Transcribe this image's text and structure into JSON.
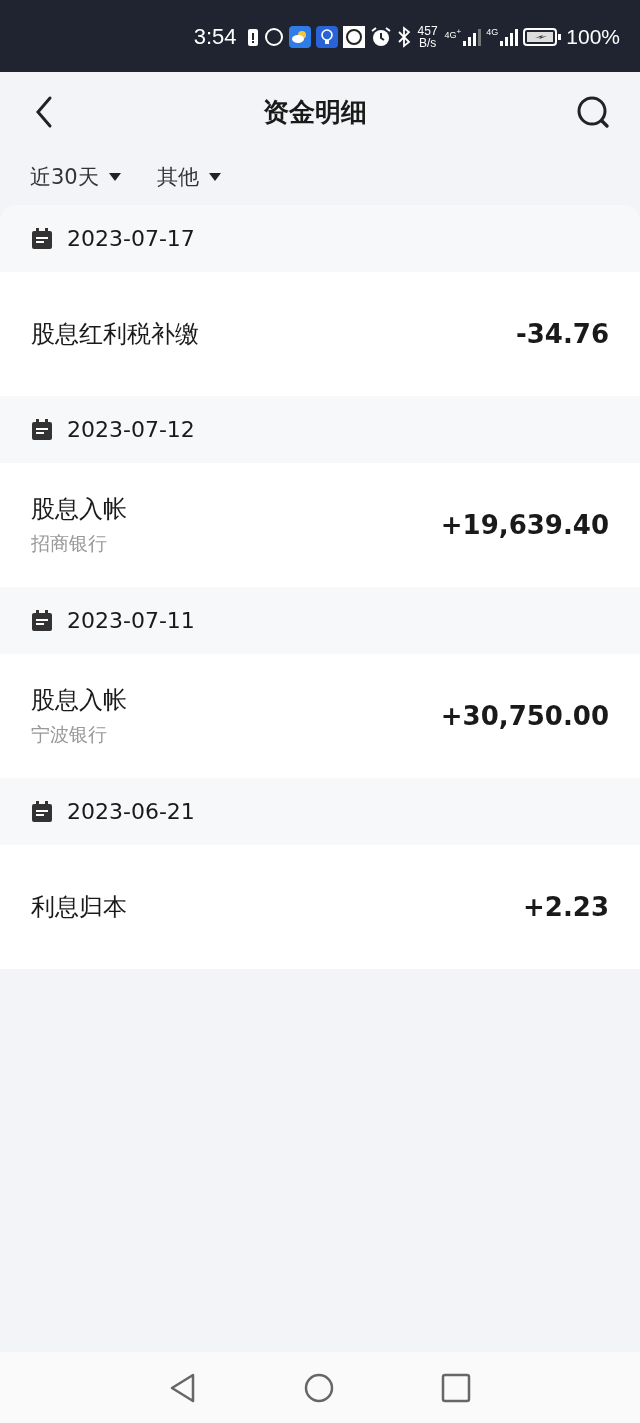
{
  "status_bar": {
    "time": "3:54",
    "net_speed": "457",
    "net_unit": "B/s",
    "signal_1": "4G$^{+}$",
    "signal_2": "4G",
    "battery": "100%"
  },
  "header": {
    "title": "资金明细"
  },
  "filters": [
    {
      "label": "近30天"
    },
    {
      "label": "其他"
    }
  ],
  "groups": [
    {
      "date": "2023-07-17",
      "items": [
        {
          "title": "股息红利税补缴",
          "amount": "-34.76"
        }
      ]
    },
    {
      "date": "2023-07-12",
      "items": [
        {
          "title": "股息入帐",
          "subtitle": "招商银行",
          "amount": "+19,639.40"
        }
      ]
    },
    {
      "date": "2023-07-11",
      "items": [
        {
          "title": "股息入帐",
          "subtitle": "宁波银行",
          "amount": "+30,750.00"
        }
      ]
    },
    {
      "date": "2023-06-21",
      "items": [
        {
          "title": "利息归本",
          "amount": "+2.23"
        }
      ]
    }
  ]
}
